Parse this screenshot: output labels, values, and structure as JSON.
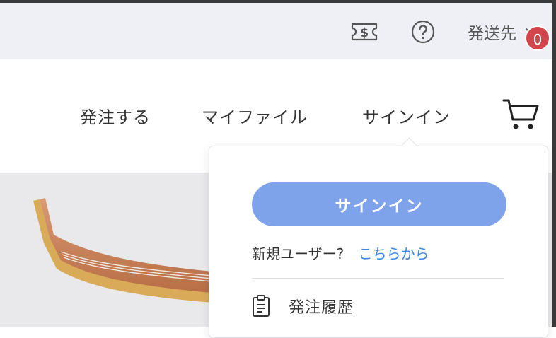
{
  "utility": {
    "icons": [
      "price-tag-dollar-icon",
      "help-circle-icon"
    ],
    "ship_to_label": "発送先"
  },
  "nav": {
    "items": [
      {
        "label": "発注する"
      },
      {
        "label": "マイファイル"
      },
      {
        "label": "サインイン"
      }
    ],
    "cart_count": "0"
  },
  "dropdown": {
    "signin_label": "サインイン",
    "new_user_text": "新規ユーザー?",
    "new_user_link": "こちらから",
    "history_label": "発注履歴"
  },
  "colors": {
    "signin_button": "#7fa3ea",
    "link": "#3d86e6",
    "badge": "#d2454c",
    "utility_bar": "#eef0f5"
  }
}
